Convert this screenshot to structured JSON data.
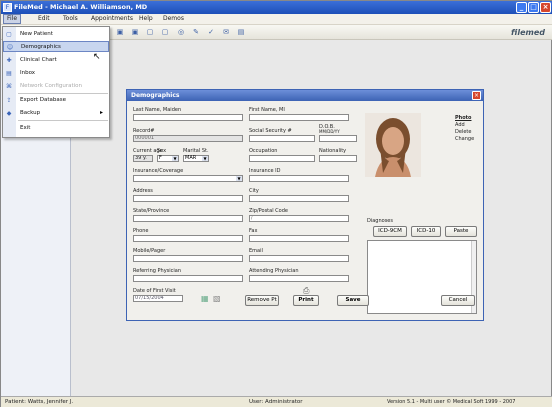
{
  "window": {
    "title": "FileMed - Michael A. Williamson, MD",
    "min": "_",
    "max": "□",
    "close": "×"
  },
  "menubar": {
    "items": [
      "File",
      "Edit",
      "Tools",
      "Appointments",
      "Help",
      "Demos"
    ]
  },
  "toolbar": {
    "brand": "filemed"
  },
  "file_menu": {
    "items": [
      {
        "label": "New Patient",
        "icon": "new-patient-icon"
      },
      {
        "label": "Demographics",
        "icon": "demographics-icon"
      },
      {
        "label": "Clinical Chart",
        "icon": "clinical-chart-icon"
      },
      {
        "label": "Inbox",
        "icon": "inbox-icon"
      },
      {
        "label": "Network Configuration",
        "icon": "network-icon"
      },
      {
        "label": "Export Database",
        "icon": "export-icon"
      },
      {
        "label": "Backup",
        "icon": "backup-icon"
      },
      {
        "label": "Exit",
        "icon": ""
      }
    ],
    "submenu_arrow": "▸"
  },
  "dialog": {
    "title": "Demographics",
    "close": "×",
    "labels": {
      "name": "Last Name, Maiden",
      "first_name": "First Name, MI",
      "record": "Record#",
      "ssn": "Social Security #",
      "dob": "D.O.B.",
      "dob_format": "MM/DD/YY",
      "current_age": "Current age",
      "sex": "Sex",
      "marital": "Marital St.",
      "occupation": "Occupation",
      "nationality": "Nationality",
      "insurance": "Insurance/Coverage",
      "insurance_id": "Insurance ID",
      "address": "Address",
      "city": "City",
      "state": "State/Province",
      "zip": "Zip/Postal Code",
      "phone": "Phone",
      "fax": "Fax",
      "mobile": "Mobile/Pager",
      "email": "Email",
      "referring": "Referring Physician",
      "attending": "Attending Physician",
      "first_visit": "Date of First Visit",
      "diagnoses": "Diagnoses"
    },
    "values": {
      "record": "000001",
      "age": "39 y.",
      "sex": "F",
      "marital": "MAR",
      "first_visit": "07/15/2004",
      "zip": "/"
    },
    "photo_links": [
      "Photo",
      "Add",
      "Delete",
      "Change"
    ],
    "buttons": {
      "icd9": "ICD-9CM",
      "icd10": "ICD-10",
      "paste": "Paste",
      "remove": "Remove Pt",
      "print": "Print",
      "save": "Save",
      "cancel": "Cancel"
    }
  },
  "statusbar": {
    "patient": "Patient: Watts, Jennifer J.",
    "user": "User: Administrator",
    "version": "Version 5.1 - Multi user  © Medical Soft 1999 - 2007"
  }
}
